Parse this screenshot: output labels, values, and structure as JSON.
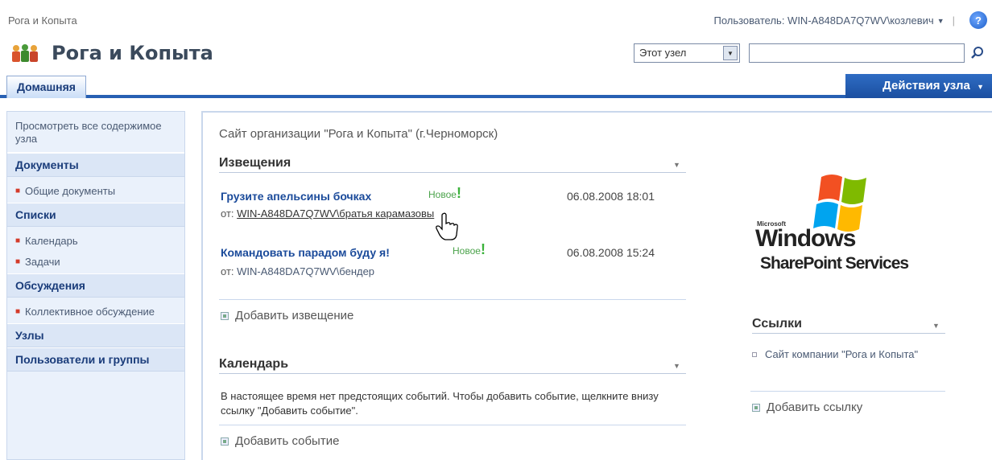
{
  "top": {
    "breadcrumb": "Рога и Копыта",
    "user_label": "Пользователь: WIN-A848DA7Q7WV\\козлевич",
    "help_glyph": "?"
  },
  "header": {
    "site_title": "Рога и Копыта",
    "scope_value": "Этот узел",
    "search_placeholder": ""
  },
  "tabs": {
    "home": "Домашняя",
    "site_actions": "Действия узла"
  },
  "leftnav": {
    "view_all": "Просмотреть все содержимое узла",
    "documents": "Документы",
    "shared_docs": "Общие документы",
    "lists": "Списки",
    "calendar": "Календарь",
    "tasks": "Задачи",
    "discussions": "Обсуждения",
    "team_discussion": "Коллективное обсуждение",
    "sites": "Узлы",
    "people": "Пользователи и группы"
  },
  "main": {
    "description": "Сайт организации \"Рога и Копыта\" (г.Черноморск)",
    "announcements": {
      "title": "Извещения",
      "items": [
        {
          "title": "Грузите апельсины бочках",
          "new": "Новое",
          "date": "06.08.2008 18:01",
          "from_label": "от:",
          "author": "WIN-A848DA7Q7WV\\братья карамазовы"
        },
        {
          "title": "Командовать парадом буду я!",
          "new": "Новое",
          "date": "06.08.2008 15:24",
          "from_label": "от:",
          "author": "WIN-A848DA7Q7WV\\бендер"
        }
      ],
      "add": "Добавить извещение"
    },
    "calendar": {
      "title": "Календарь",
      "empty_text": "В настоящее время нет предстоящих событий. Чтобы добавить событие, щелкните внизу ссылку \"Добавить событие\".",
      "add": "Добавить событие"
    },
    "logo": {
      "microsoft": "Microsoft",
      "windows": "Windows",
      "sps": "SharePoint Services"
    },
    "links": {
      "title": "Ссылки",
      "items": [
        "Сайт компании \"Рога и Копыта\""
      ],
      "add": "Добавить ссылку"
    }
  },
  "colors": {
    "accent": "#2760b3",
    "nav_bg": "#eaf1fb",
    "new_badge": "#4ba34b"
  }
}
